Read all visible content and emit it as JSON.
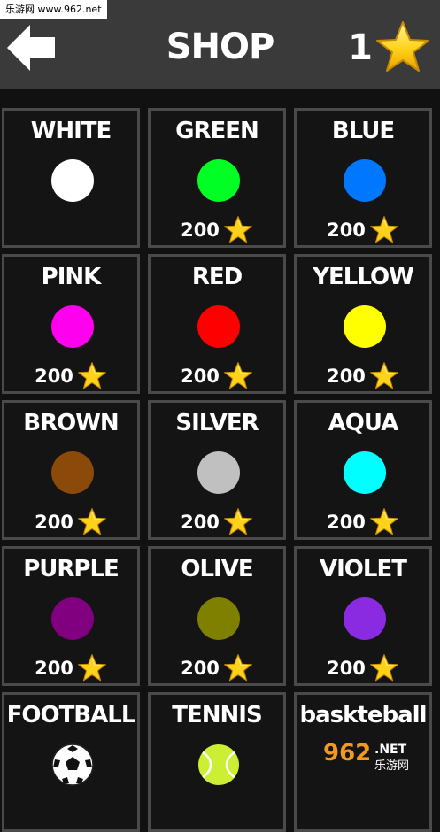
{
  "watermark": "乐游网 www.962.net",
  "header": {
    "title": "SHOP",
    "star_count": "1"
  },
  "items": [
    {
      "label": "WHITE",
      "color": "#ffffff",
      "price": ""
    },
    {
      "label": "GREEN",
      "color": "#00ff22",
      "price": "200"
    },
    {
      "label": "BLUE",
      "color": "#0077ff",
      "price": "200"
    },
    {
      "label": "PINK",
      "color": "#ff00ee",
      "price": "200"
    },
    {
      "label": "RED",
      "color": "#ff0000",
      "price": "200"
    },
    {
      "label": "YELLOW",
      "color": "#ffff00",
      "price": "200"
    },
    {
      "label": "BROWN",
      "color": "#8b4a0a",
      "price": "200"
    },
    {
      "label": "SILVER",
      "color": "#c0c0c0",
      "price": "200"
    },
    {
      "label": "AQUA",
      "color": "#00ffff",
      "price": "200"
    },
    {
      "label": "PURPLE",
      "color": "#800080",
      "price": "200"
    },
    {
      "label": "OLIVE",
      "color": "#808000",
      "price": "200"
    },
    {
      "label": "VIOLET",
      "color": "#8a2be2",
      "price": "200"
    },
    {
      "label": "FOOTBALL",
      "color": "",
      "price": ""
    },
    {
      "label": "TENNIS",
      "color": "#ccee33",
      "price": ""
    },
    {
      "label": "baskteball",
      "color": "",
      "price": ""
    }
  ],
  "logo_watermark": "962.NET 乐游网",
  "icons": {
    "back": "back-arrow-icon",
    "star": "star-icon",
    "football": "football-icon",
    "tennis": "tennis-ball-icon"
  }
}
